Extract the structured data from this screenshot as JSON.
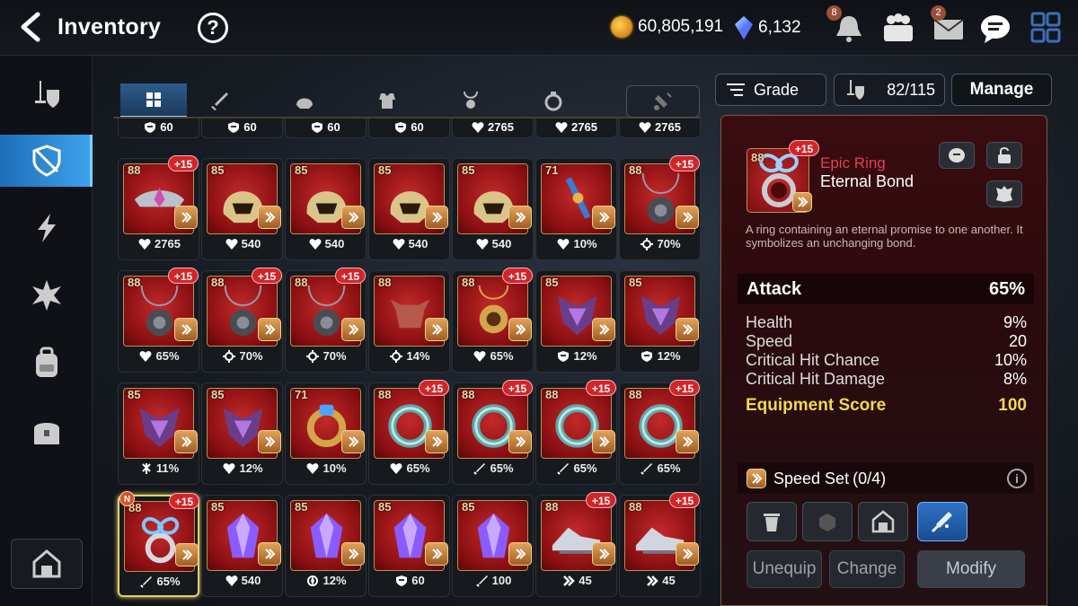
{
  "header": {
    "title": "Inventory",
    "help": "?",
    "gold": "60,805,191",
    "gems": "6,132",
    "notif_count": "8",
    "mail_count": "2"
  },
  "tabs": [
    "all",
    "weapon",
    "helmet",
    "armor",
    "necklace",
    "ring",
    "boots"
  ],
  "top_partial": [
    {
      "icon": "shield",
      "value": "60"
    },
    {
      "icon": "shield",
      "value": "60"
    },
    {
      "icon": "shield",
      "value": "60"
    },
    {
      "icon": "shield",
      "value": "60"
    },
    {
      "icon": "heart",
      "value": "2765"
    },
    {
      "icon": "heart",
      "value": "2765"
    },
    {
      "icon": "heart",
      "value": "2765"
    }
  ],
  "items": [
    [
      {
        "lvl": "88",
        "enh": "+15",
        "stat": "heart",
        "val": "2765",
        "kind": "tiara"
      },
      {
        "lvl": "85",
        "enh": "",
        "stat": "heart",
        "val": "540",
        "kind": "helm"
      },
      {
        "lvl": "85",
        "enh": "",
        "stat": "heart",
        "val": "540",
        "kind": "helm"
      },
      {
        "lvl": "85",
        "enh": "",
        "stat": "heart",
        "val": "540",
        "kind": "helm"
      },
      {
        "lvl": "85",
        "enh": "",
        "stat": "heart",
        "val": "540",
        "kind": "helm"
      },
      {
        "lvl": "71",
        "enh": "",
        "stat": "heart",
        "val": "10%",
        "kind": "amulet"
      },
      {
        "lvl": "88",
        "enh": "+15",
        "stat": "gear",
        "val": "70%",
        "kind": "pendant"
      }
    ],
    [
      {
        "lvl": "88",
        "enh": "+15",
        "stat": "heart",
        "val": "65%",
        "kind": "pendant"
      },
      {
        "lvl": "88",
        "enh": "+15",
        "stat": "gear",
        "val": "70%",
        "kind": "pendant"
      },
      {
        "lvl": "88",
        "enh": "+15",
        "stat": "gear",
        "val": "70%",
        "kind": "pendant"
      },
      {
        "lvl": "88",
        "enh": "",
        "stat": "gear",
        "val": "14%",
        "kind": "bull"
      },
      {
        "lvl": "88",
        "enh": "+15",
        "stat": "heart",
        "val": "65%",
        "kind": "gold"
      },
      {
        "lvl": "85",
        "enh": "",
        "stat": "shield",
        "val": "12%",
        "kind": "dragon"
      },
      {
        "lvl": "85",
        "enh": "",
        "stat": "shield",
        "val": "12%",
        "kind": "dragon"
      }
    ],
    [
      {
        "lvl": "85",
        "enh": "",
        "stat": "bolt",
        "val": "11%",
        "kind": "dragon"
      },
      {
        "lvl": "85",
        "enh": "",
        "stat": "heart",
        "val": "12%",
        "kind": "dragon"
      },
      {
        "lvl": "71",
        "enh": "",
        "stat": "heart",
        "val": "10%",
        "kind": "goldring"
      },
      {
        "lvl": "88",
        "enh": "+15",
        "stat": "heart",
        "val": "65%",
        "kind": "ring"
      },
      {
        "lvl": "88",
        "enh": "+15",
        "stat": "sword",
        "val": "65%",
        "kind": "ring"
      },
      {
        "lvl": "88",
        "enh": "+15",
        "stat": "sword",
        "val": "65%",
        "kind": "ring"
      },
      {
        "lvl": "88",
        "enh": "+15",
        "stat": "sword",
        "val": "65%",
        "kind": "ring"
      }
    ],
    [
      {
        "lvl": "88",
        "enh": "+15",
        "stat": "sword",
        "val": "65%",
        "kind": "infinity",
        "new": "N"
      },
      {
        "lvl": "85",
        "enh": "",
        "stat": "heart",
        "val": "540",
        "kind": "crystal"
      },
      {
        "lvl": "85",
        "enh": "",
        "stat": "crit",
        "val": "12%",
        "kind": "crystal"
      },
      {
        "lvl": "85",
        "enh": "",
        "stat": "shield",
        "val": "60",
        "kind": "crystal"
      },
      {
        "lvl": "85",
        "enh": "",
        "stat": "sword",
        "val": "100",
        "kind": "crystal"
      },
      {
        "lvl": "88",
        "enh": "+15",
        "stat": "speed",
        "val": "45",
        "kind": "boots"
      },
      {
        "lvl": "88",
        "enh": "+15",
        "stat": "speed",
        "val": "45",
        "kind": "boots"
      }
    ]
  ],
  "panel": {
    "grade_label": "Grade",
    "capacity": "82/115",
    "manage": "Manage"
  },
  "detail": {
    "level": "88",
    "enhance": "+15",
    "grade": "Epic Ring",
    "name": "Eternal Bond",
    "description": "A ring containing an eternal promise to one another. It symbolizes an unchanging bond.",
    "main_stat": {
      "name": "Attack",
      "value": "65%"
    },
    "substats": [
      {
        "name": "Health",
        "value": "9%"
      },
      {
        "name": "Speed",
        "value": "20"
      },
      {
        "name": "Critical Hit Chance",
        "value": "10%"
      },
      {
        "name": "Critical Hit Damage",
        "value": "8%"
      }
    ],
    "score_label": "Equipment Score",
    "score": "100",
    "set_name": "Speed Set",
    "set_count": "(0/4)",
    "unequip": "Unequip",
    "change": "Change",
    "modify": "Modify"
  },
  "colors": {
    "accent_blue": "#3fa3ee",
    "epic": "#e0405a",
    "score": "#f2d94a",
    "enhance": "#d0262a"
  }
}
